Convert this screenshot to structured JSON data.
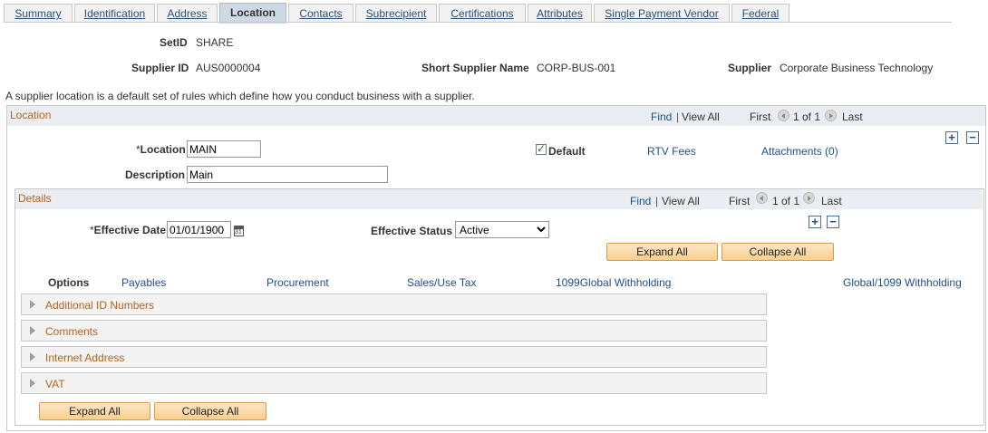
{
  "tabs": [
    {
      "label": "Summary",
      "active": false
    },
    {
      "label": "Identification",
      "active": false
    },
    {
      "label": "Address",
      "active": false
    },
    {
      "label": "Location",
      "active": true
    },
    {
      "label": "Contacts",
      "active": false
    },
    {
      "label": "Subrecipient",
      "active": false
    },
    {
      "label": "Certifications",
      "active": false
    },
    {
      "label": "Attributes",
      "active": false
    },
    {
      "label": "Single Payment Vendor",
      "active": false
    },
    {
      "label": "Federal",
      "active": false
    }
  ],
  "header": {
    "setid_label": "SetID",
    "setid_value": "SHARE",
    "supplier_id_label": "Supplier ID",
    "supplier_id_value": "AUS0000004",
    "short_name_label": "Short Supplier Name",
    "short_name_value": "CORP-BUS-001",
    "supplier_label": "Supplier",
    "supplier_value": "Corporate Business Technology"
  },
  "description_text": "A supplier location is a default set of rules which define how you conduct business with a supplier.",
  "location": {
    "title": "Location",
    "find": "Find",
    "view_all": "View All",
    "first": "First",
    "count": "1 of 1",
    "last": "Last",
    "location_label": "Location",
    "location_value": "MAIN",
    "description_label": "Description",
    "description_value": "Main",
    "default_label": "Default",
    "default_checked": true,
    "rtv_fees": "RTV Fees",
    "attachments": "Attachments (0)"
  },
  "details": {
    "title": "Details",
    "find": "Find",
    "view_all": "View All",
    "first": "First",
    "count": "1 of 1",
    "last": "Last",
    "effective_date_label": "Effective Date",
    "effective_date_value": "01/01/1900",
    "effective_status_label": "Effective Status",
    "effective_status_value": "Active",
    "expand_all": "Expand All",
    "collapse_all": "Collapse All",
    "options_label": "Options",
    "option_links": [
      "Payables",
      "Procurement",
      "Sales/Use Tax",
      "1099Global Withholding",
      "Global/1099 Withholding"
    ],
    "sections": [
      "Additional ID Numbers",
      "Comments",
      "Internet Address",
      "VAT"
    ],
    "bottom_expand_all": "Expand All",
    "bottom_collapse_all": "Collapse All"
  },
  "colors": {
    "link": "#1f4e8a",
    "section_title": "#b5601b",
    "button": "#f8cf8e"
  }
}
